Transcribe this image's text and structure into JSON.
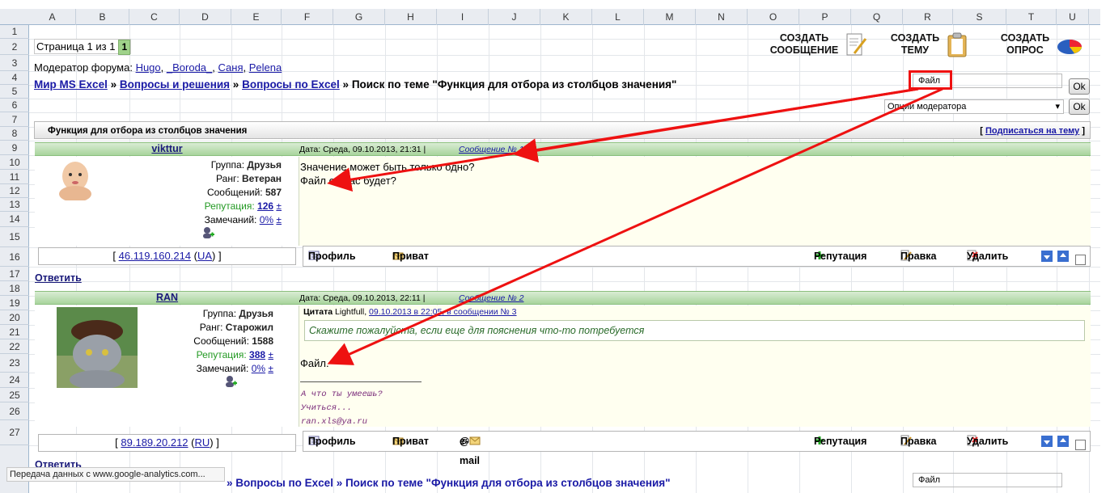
{
  "columns": [
    "A",
    "B",
    "C",
    "D",
    "E",
    "F",
    "G",
    "H",
    "I",
    "J",
    "K",
    "L",
    "M",
    "N",
    "O",
    "P",
    "Q",
    "R",
    "S",
    "T",
    "U"
  ],
  "rows": [
    "1",
    "2",
    "3",
    "4",
    "5",
    "6",
    "7",
    "8",
    "9",
    "10",
    "11",
    "12",
    "13",
    "14",
    "15",
    "16",
    "17",
    "18",
    "19",
    "20",
    "21",
    "22",
    "23",
    "24",
    "25",
    "26",
    "27"
  ],
  "pager": {
    "label": "Страница 1 из 1",
    "current": "1"
  },
  "moderators": {
    "label": "Модератор форума:",
    "names": [
      "Hugo",
      "_Boroda_",
      "Саня",
      "Pelena"
    ]
  },
  "breadcrumb": {
    "items": [
      "Мир MS Excel",
      "Вопросы и решения",
      "Вопросы по Excel"
    ],
    "sep": "»",
    "current": "Поиск по теме \"Функция для отбора из столбцов значения\""
  },
  "toolbar": {
    "new_message": [
      "СОЗДАТЬ",
      "СООБЩЕНИЕ"
    ],
    "new_topic": [
      "СОЗДАТЬ",
      "ТЕМУ"
    ],
    "new_poll": [
      "СОЗДАТЬ",
      "ОПРОС"
    ]
  },
  "search": {
    "value": "Файл",
    "ok": "Ok"
  },
  "mod_options": {
    "value": "Опции модератора",
    "ok": "Ok"
  },
  "topic": {
    "title": "Функция для отбора из столбцов значения",
    "subscribe_open": "[",
    "subscribe": "Подписаться на тему",
    "subscribe_close": "]"
  },
  "posts": [
    {
      "author": "vikttur",
      "meta_prefix": "Дата: Среда, 09.10.2013, 21:31 |",
      "msg_label": "Сообщение № 1",
      "group_label": "Группа:",
      "group": "Друзья",
      "rank_label": "Ранг:",
      "rank": "Ветеран",
      "count_label": "Сообщений:",
      "count": "587",
      "rep_label": "Репутация:",
      "rep": "126",
      "pm": "±",
      "warn_label": "Замечаний:",
      "warn": "0%",
      "warn_pm": "±",
      "lines": [
        "Значение может быть только одно?",
        "Файл от Вас будет?"
      ],
      "ip": "46.119.160.214",
      "ip_tag": "UA"
    },
    {
      "author": "RAN",
      "meta_prefix": "Дата: Среда, 09.10.2013, 22:11 |",
      "msg_label": "Сообщение № 2",
      "group_label": "Группа:",
      "group": "Друзья",
      "rank_label": "Ранг:",
      "rank": "Старожил",
      "count_label": "Сообщений:",
      "count": "1588",
      "rep_label": "Репутация:",
      "rep": "388",
      "pm": "±",
      "warn_label": "Замечаний:",
      "warn": "0%",
      "warn_pm": "±",
      "quote_label": "Цитата",
      "quote_author": "Lightfull,",
      "quote_link": "09.10.2013 в 22:05, в сообщении № 3",
      "quote_text": "Скажите пожалуйста, если еще для пояснения что-то потребуется",
      "lines": [
        "Файл."
      ],
      "signature": [
        "А что ты умеешь?",
        "Учиться...",
        "ran.xls@ya.ru"
      ],
      "ip": "89.189.20.212",
      "ip_tag": "RU"
    }
  ],
  "actions": {
    "profile": "Профиль",
    "private": "Приват",
    "email": "e-mail",
    "reputation": "Репутация",
    "edit": "Правка",
    "delete": "Удалить"
  },
  "reply": "Ответить",
  "bottom_crumb": "» Вопросы по Excel » Поиск по теме \"Функция для отбора из столбцов значения\"",
  "bottom_search": "Файл",
  "status": "Передача данных с www.google-analytics.com..."
}
